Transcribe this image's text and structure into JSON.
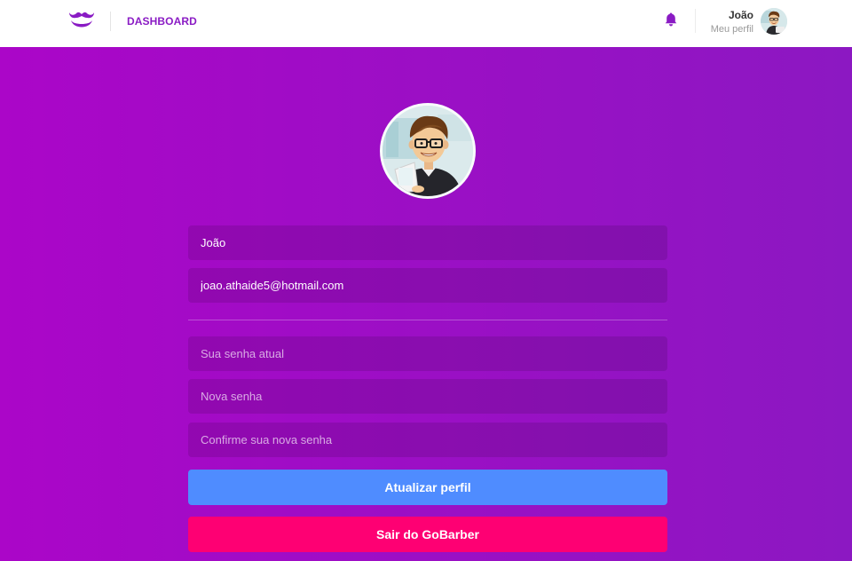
{
  "header": {
    "nav_label": "DASHBOARD",
    "profile": {
      "name": "João",
      "link_label": "Meu perfil"
    },
    "icons": {
      "logo": "mustache-logo-icon",
      "notifications": "bell-icon"
    }
  },
  "form": {
    "name_value": "João",
    "email_value": "joao.athaide5@hotmail.com",
    "old_password_placeholder": "Sua senha atual",
    "new_password_placeholder": "Nova senha",
    "confirm_password_placeholder": "Confirme sua nova senha",
    "submit_label": "Atualizar perfil",
    "logout_label": "Sair do GoBarber"
  },
  "colors": {
    "brand": "#8a1bc4",
    "background_start": "#ab06c8",
    "background_end": "#8c18c2",
    "primary_button": "#4f8cff",
    "logout_button": "#fe0073"
  }
}
